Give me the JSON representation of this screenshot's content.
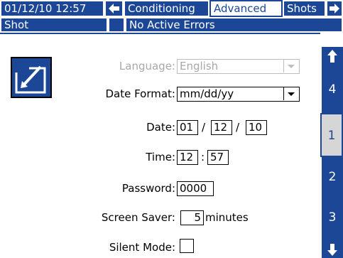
{
  "tabs": {
    "datetime": "01/12/10 12:57",
    "items": [
      {
        "label": "Conditioning"
      },
      {
        "label": "Advanced"
      },
      {
        "label": "Shots"
      }
    ]
  },
  "status": {
    "mode": "Shot",
    "message": "No Active Errors"
  },
  "form": {
    "language_label": "Language:",
    "language_value": "English",
    "date_format_label": "Date Format:",
    "date_format_value": "mm/dd/yy",
    "date_label": "Date:",
    "date_month": "01",
    "date_day": "12",
    "date_year": "10",
    "date_sep": "/",
    "time_label": "Time:",
    "time_hour": "12",
    "time_minute": "57",
    "time_sep": ":",
    "password_label": "Password:",
    "password_value": "0000",
    "screensaver_label": "Screen Saver:",
    "screensaver_value": "5",
    "screensaver_unit": "minutes",
    "silent_label": "Silent Mode:"
  },
  "nav": {
    "pages": [
      "4",
      "1",
      "2",
      "3"
    ],
    "selected": "1"
  },
  "colors": {
    "accent": "#1c4796",
    "selected_nav": "#d6d6d6"
  }
}
